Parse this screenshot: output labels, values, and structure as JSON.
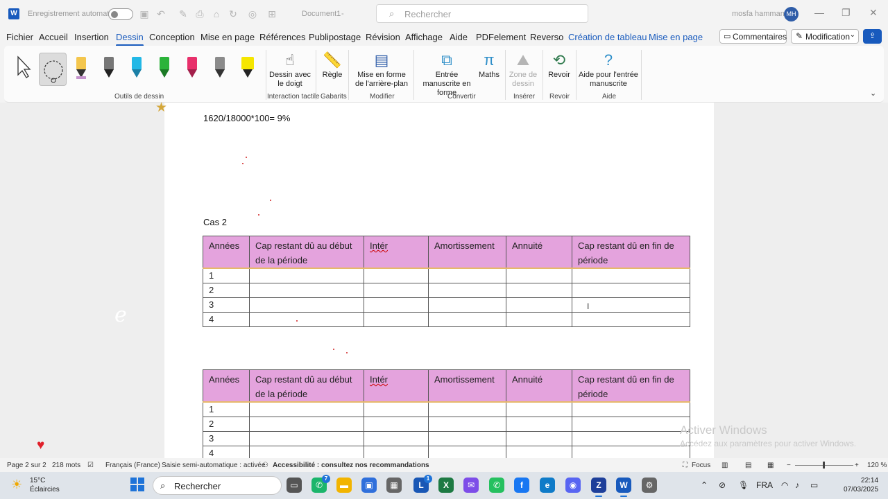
{
  "titlebar": {
    "autosave_label": "Enregistrement automatique",
    "doc_title": "Document1",
    "doc_title_suffix": "-",
    "search_placeholder": "Rechercher",
    "user_name": "mosfa hammani",
    "user_initials": "MH"
  },
  "menu": {
    "items": [
      "Fichier",
      "Accueil",
      "Insertion",
      "Dessin",
      "Conception",
      "Mise en page",
      "Références",
      "Publipostage",
      "Révision",
      "Affichage",
      "Aide",
      "PDFelement",
      "Reverso"
    ],
    "active": "Dessin",
    "context_tabs": [
      "Création de tableau",
      "Mise en page"
    ],
    "comments_label": "Commentaires",
    "edit_mode_label": "Modification"
  },
  "ribbon": {
    "groups": {
      "drawing_tools": "Outils de dessin",
      "touch": "Interaction tactile",
      "templates": "Gabarits",
      "modify": "Modifier",
      "convert": "Convertir",
      "insert": "Insérer",
      "review": "Revoir",
      "help": "Aide"
    },
    "buttons": {
      "finger_draw": "Dessin avec le doigt",
      "ruler": "Règle",
      "background": "Mise en forme de l'arrière-plan",
      "ink_to_shape": "Entrée manuscrite en forme",
      "math": "Maths",
      "drawing_canvas": "Zone de dessin",
      "replay": "Revoir",
      "ink_help": "Aide pour l'entrée manuscrite"
    },
    "pen_colors": [
      "#f4c64d",
      "#333333",
      "#22b8e6",
      "#2bb33a",
      "#e8306b",
      "#8b8b8b",
      "#f5e600"
    ]
  },
  "document": {
    "formula_line": "1620/18000*100= 9%",
    "case_label": "Cas 2",
    "table_headers": [
      "Années",
      "Cap restant dû au début de la période",
      "Intér",
      "Amortissement",
      "Annuité",
      "Cap restant dû en fin de période"
    ],
    "table1_rows": [
      "1",
      "2",
      "3",
      "4"
    ],
    "table2_rows": [
      "1",
      "2",
      "3",
      "4"
    ]
  },
  "watermark": {
    "line1": "Activer Windows",
    "line2": "Accédez aux paramètres pour activer Windows."
  },
  "statusbar": {
    "page": "Page 2 sur 2",
    "words": "218 mots",
    "language": "Français (France)",
    "autocomplete": "Saisie semi-automatique : activée",
    "accessibility": "Accessibilité : consultez nos recommandations",
    "focus": "Focus",
    "zoom": "120 %"
  },
  "taskbar": {
    "temperature": "15°C",
    "weather": "Éclaircies",
    "search_label": "Rechercher",
    "language": "FRA",
    "time": "22:14",
    "date": "07/03/2025",
    "whatsapp_badge": "7",
    "teams_badge": "1"
  }
}
